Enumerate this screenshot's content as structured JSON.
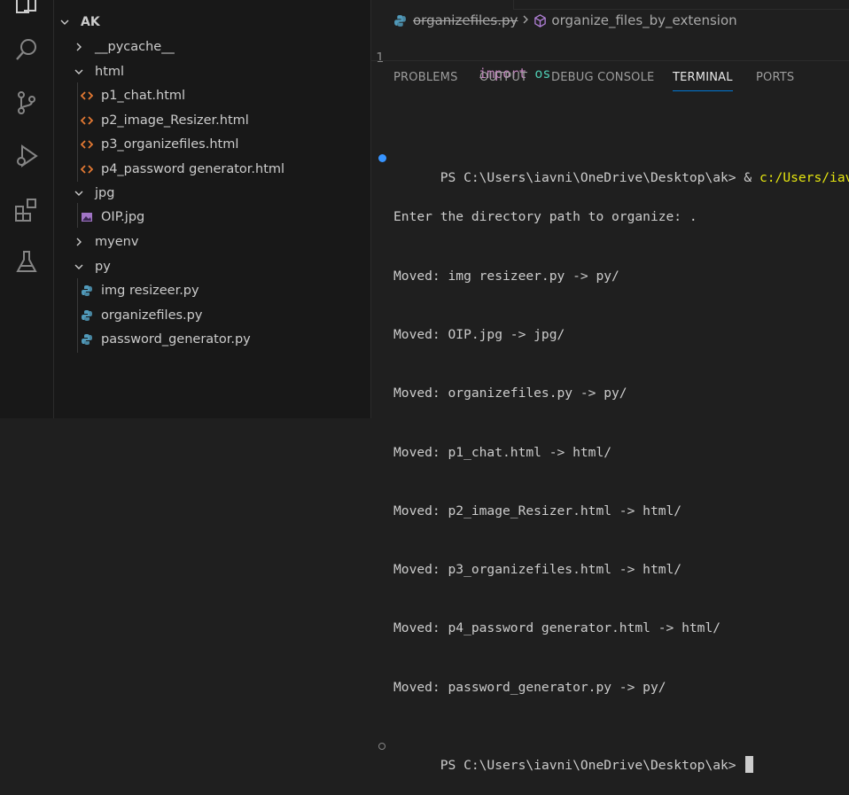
{
  "activity_bar": {
    "icons": [
      "explorer-icon",
      "search-icon",
      "source-control-icon",
      "run-debug-icon",
      "extensions-icon",
      "testing-icon"
    ]
  },
  "explorer": {
    "root": "AK",
    "items": [
      {
        "label": "__pycache__",
        "type": "folder",
        "expanded": false
      },
      {
        "label": "html",
        "type": "folder",
        "expanded": true
      },
      {
        "label": "p1_chat.html",
        "type": "html"
      },
      {
        "label": "p2_image_Resizer.html",
        "type": "html"
      },
      {
        "label": "p3_organizefiles.html",
        "type": "html"
      },
      {
        "label": "p4_password generator.html",
        "type": "html"
      },
      {
        "label": "jpg",
        "type": "folder",
        "expanded": true
      },
      {
        "label": "OIP.jpg",
        "type": "image"
      },
      {
        "label": "myenv",
        "type": "folder",
        "expanded": false
      },
      {
        "label": "py",
        "type": "folder",
        "expanded": true
      },
      {
        "label": "img resizeer.py",
        "type": "python"
      },
      {
        "label": "organizefiles.py",
        "type": "python"
      },
      {
        "label": "password_generator.py",
        "type": "python"
      }
    ]
  },
  "editor": {
    "breadcrumb_file": "organizefiles.py",
    "breadcrumb_symbol": "organize_files_by_extension",
    "line_number": "1",
    "code_keyword": "import",
    "code_module": "os"
  },
  "panel": {
    "tabs": [
      "PROBLEMS",
      "OUTPUT",
      "DEBUG CONSOLE",
      "TERMINAL",
      "PORTS"
    ],
    "active_tab": "TERMINAL"
  },
  "terminal": {
    "prompt1": "PS C:\\Users\\iavni\\OneDrive\\Desktop\\ak> ",
    "command1_amp": "& ",
    "command1_path": "c:/Users/iavni/O",
    "lines": [
      "Enter the directory path to organize: .",
      "Moved: img resizeer.py -> py/",
      "Moved: OIP.jpg -> jpg/",
      "Moved: organizefiles.py -> py/",
      "Moved: p1_chat.html -> html/",
      "Moved: p2_image_Resizer.html -> html/",
      "Moved: p3_organizefiles.html -> html/",
      "Moved: p4_password generator.html -> html/",
      "Moved: password_generator.py -> py/"
    ],
    "prompt2": "PS C:\\Users\\iavni\\OneDrive\\Desktop\\ak> "
  },
  "colors": {
    "html_icon": "#e37933",
    "python_icon": "#519aba",
    "image_icon": "#a074c4",
    "keyword": "#c586c0",
    "module": "#4ec9b0",
    "terminal_path": "#e5e510",
    "accent": "#0078d4"
  }
}
